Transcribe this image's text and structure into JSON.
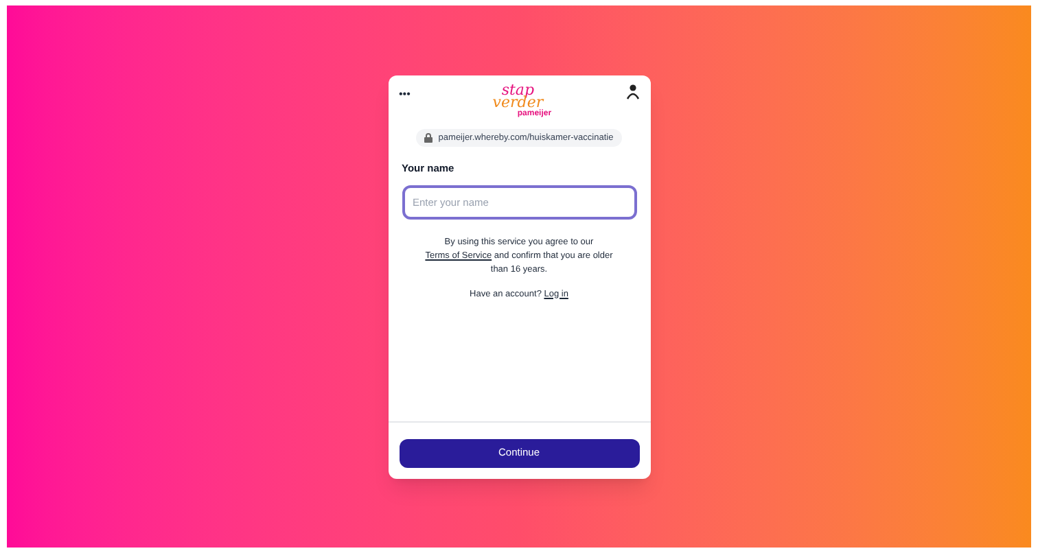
{
  "header": {
    "menu_label": "•••",
    "logo": {
      "line_1": "stap",
      "line_2": "verder",
      "line_3": "pameijer"
    }
  },
  "url_chip": {
    "text": "pameijer.whereby.com/huiskamer-vaccinatie"
  },
  "name_field": {
    "label": "Your name",
    "placeholder": "Enter your name",
    "focused": true
  },
  "terms": {
    "before": "By using this service you agree to our",
    "link": "Terms of Service",
    "after": "and confirm that you are older than 16 years."
  },
  "account": {
    "text": "Have an account?",
    "link": "Log in"
  },
  "continue_button": {
    "label": "Continue"
  }
}
